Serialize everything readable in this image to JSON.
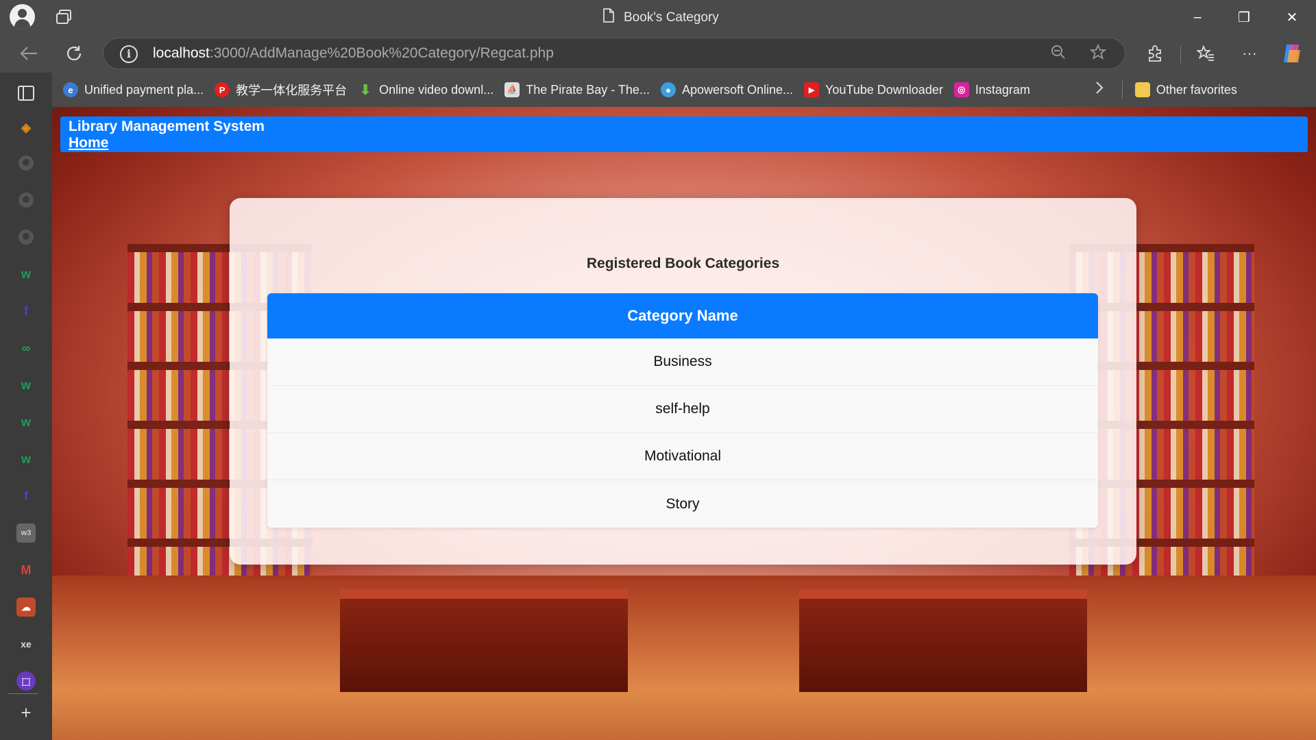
{
  "browser": {
    "tab_title": "Book's Category",
    "url_host": "localhost",
    "url_rest": ":3000/AddManage%20Book%20Category/Regcat.php",
    "minimize": "–",
    "restore": "❐",
    "close": "✕",
    "menu": "···"
  },
  "favorites": [
    {
      "label": "Unified payment pla...",
      "icon": "payment-icon",
      "color": "#3a7bd5",
      "glyph": "e"
    },
    {
      "label": "教学一体化服务平台",
      "icon": "p-letter-icon",
      "color": "#e02020",
      "glyph": "P"
    },
    {
      "label": "Online video downl...",
      "icon": "download-arrow-icon",
      "color": "#6cc04a",
      "glyph": "⬇"
    },
    {
      "label": "The Pirate Bay - The...",
      "icon": "pirate-ship-icon",
      "color": "#dddddd",
      "glyph": "⛵"
    },
    {
      "label": "Apowersoft Online...",
      "icon": "apowersoft-icon",
      "color": "#3aa0e0",
      "glyph": "●"
    },
    {
      "label": "YouTube Downloader",
      "icon": "youtube-icon",
      "color": "#e02020",
      "glyph": "▶"
    },
    {
      "label": "Instagram",
      "icon": "instagram-icon",
      "color": "#d6249f",
      "glyph": "◎"
    }
  ],
  "other_favorites": "Other favorites",
  "page": {
    "app_name": "Library Management System",
    "home_link": "Home",
    "heading": "Registered Book Categories",
    "column_header": "Category Name",
    "categories": [
      "Business",
      "self-help",
      "Motivational",
      "Story"
    ]
  },
  "colors": {
    "header_blue": "#0a7bff"
  }
}
